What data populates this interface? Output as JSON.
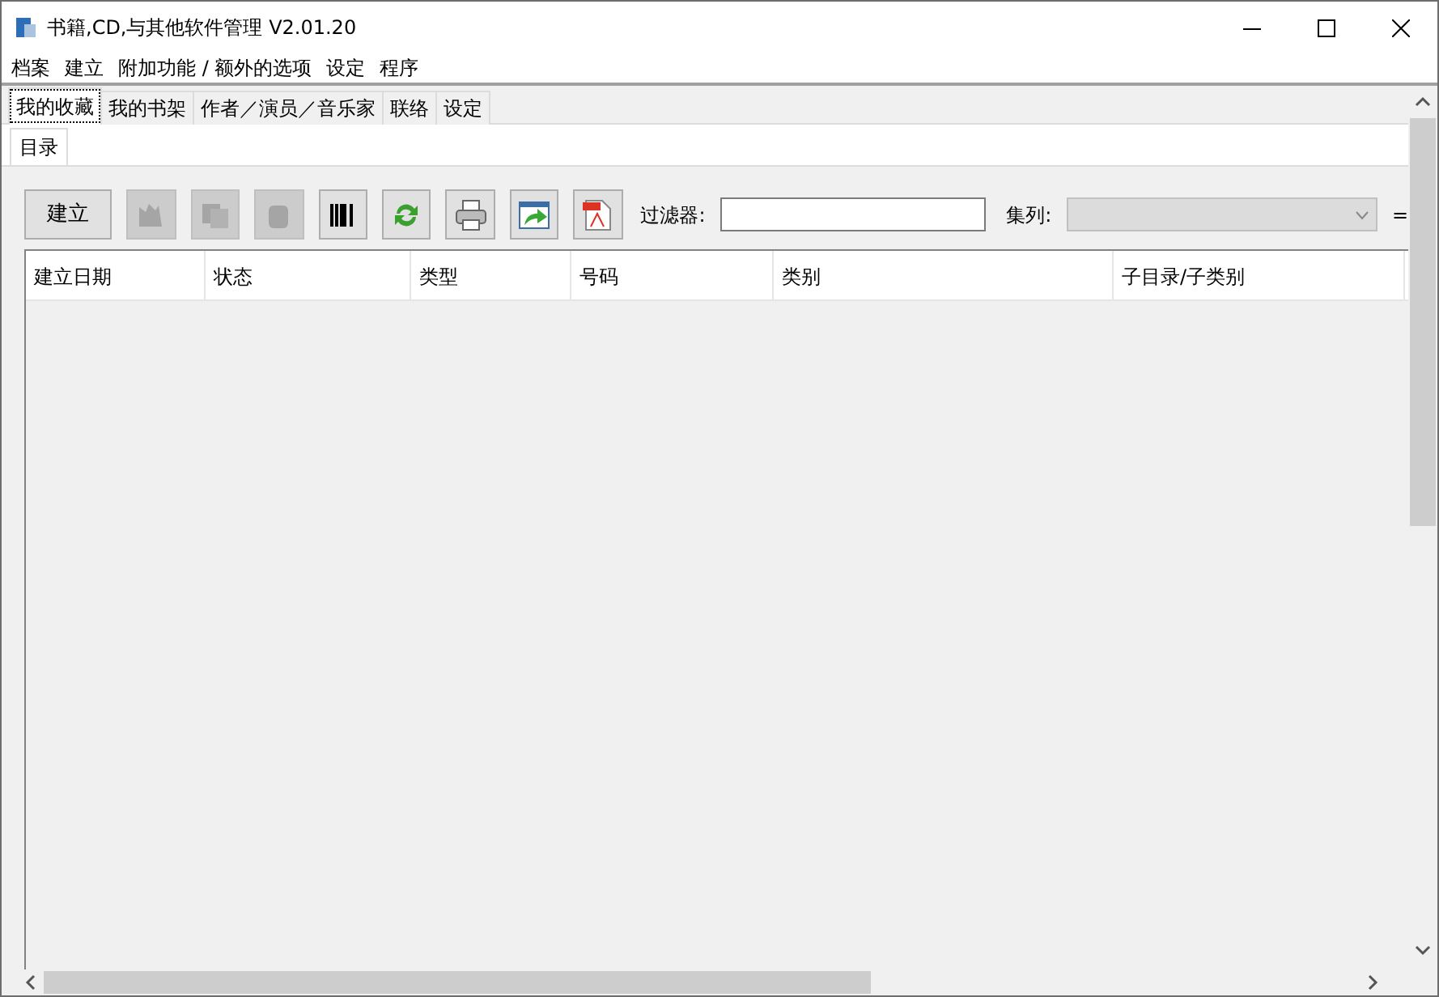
{
  "window": {
    "title": "书籍,CD,与其他软件管理 V2.01.20"
  },
  "menu": [
    "档案",
    "建立",
    "附加功能 / 额外的选项",
    "设定",
    "程序"
  ],
  "tabs": [
    {
      "label": "我的收藏",
      "selected": true
    },
    {
      "label": "我的书架",
      "selected": false
    },
    {
      "label": "作者／演员／音乐家",
      "selected": false
    },
    {
      "label": "联络",
      "selected": false
    },
    {
      "label": "设定",
      "selected": false
    }
  ],
  "subtabs": [
    {
      "label": "目录",
      "selected": true
    }
  ],
  "toolbar": [
    {
      "kind": "text",
      "label": "建立",
      "disabled": false
    },
    {
      "kind": "edit",
      "disabled": true
    },
    {
      "kind": "copy",
      "disabled": true
    },
    {
      "kind": "trash",
      "disabled": true
    },
    {
      "kind": "barcode",
      "disabled": false
    },
    {
      "kind": "refresh",
      "disabled": false
    },
    {
      "kind": "print",
      "disabled": false
    },
    {
      "kind": "export",
      "disabled": false
    },
    {
      "kind": "pdf",
      "disabled": false
    }
  ],
  "filter": {
    "label": "过滤器:"
  },
  "collection": {
    "label": "集列:",
    "disabled": true
  },
  "extra": "=",
  "table": {
    "columns": [
      "建立日期",
      "状态",
      "类型",
      "号码",
      "类别",
      "子目录/子类别"
    ]
  }
}
